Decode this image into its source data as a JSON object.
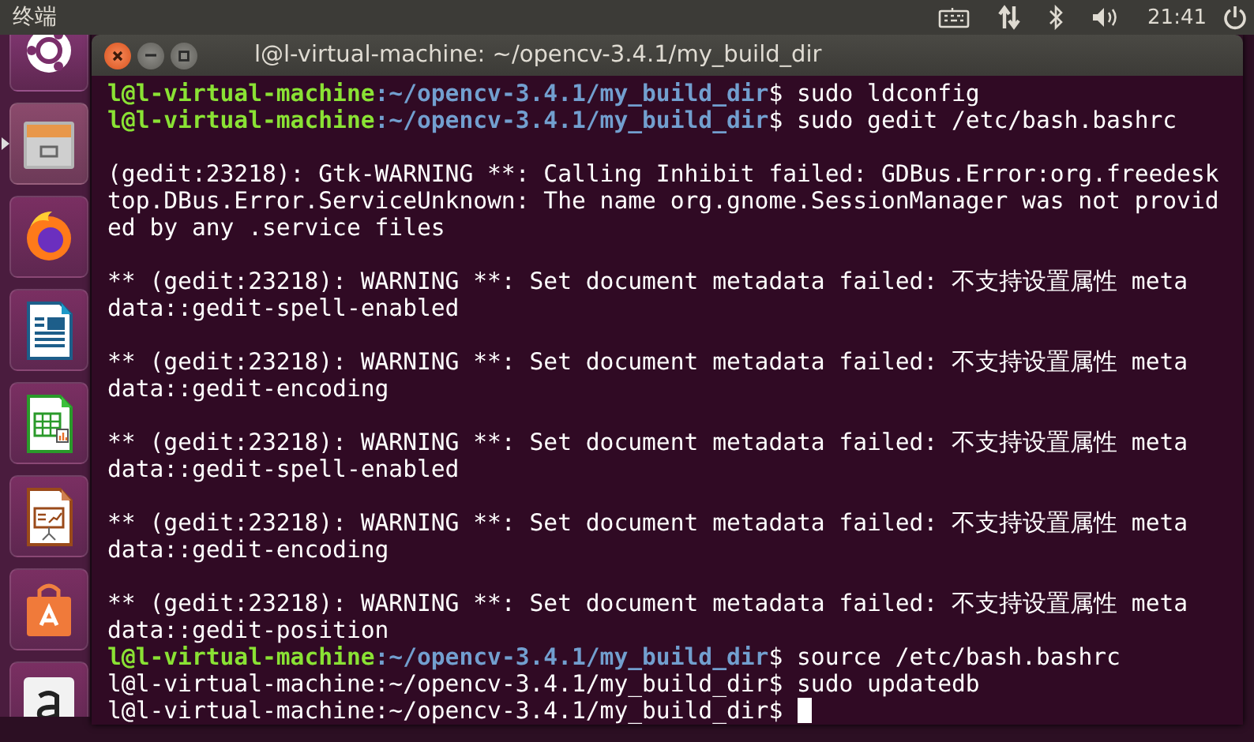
{
  "top_bar": {
    "app_title": "终端",
    "time": "21:41"
  },
  "launcher": {
    "items": [
      {
        "kind": "dash",
        "running": false
      },
      {
        "kind": "files",
        "running": true
      },
      {
        "kind": "browser",
        "running": false
      },
      {
        "kind": "writer",
        "running": false
      },
      {
        "kind": "calc",
        "running": false
      },
      {
        "kind": "impress",
        "running": false
      },
      {
        "kind": "software",
        "running": false
      },
      {
        "kind": "amazon",
        "running": false
      }
    ]
  },
  "terminal": {
    "title": "l@l-virtual-machine: ~/opencv-3.4.1/my_build_dir",
    "lines": [
      {
        "kind": "prompt",
        "colored": true,
        "user": "l@l-virtual-machine",
        "path": ":~/opencv-3.4.1/my_build_dir",
        "command": "$ sudo ldconfig"
      },
      {
        "kind": "prompt",
        "colored": true,
        "user": "l@l-virtual-machine",
        "path": ":~/opencv-3.4.1/my_build_dir",
        "command": "$ sudo gedit /etc/bash.bashrc"
      },
      {
        "kind": "blank"
      },
      {
        "kind": "output",
        "text": "(gedit:23218): Gtk-WARNING **: Calling Inhibit failed: GDBus.Error:org.freedesk"
      },
      {
        "kind": "output",
        "text": "top.DBus.Error.ServiceUnknown: The name org.gnome.SessionManager was not provid"
      },
      {
        "kind": "output",
        "text": "ed by any .service files"
      },
      {
        "kind": "blank"
      },
      {
        "kind": "output",
        "text": "** (gedit:23218): WARNING **: Set document metadata failed: 不支持设置属性 meta"
      },
      {
        "kind": "output",
        "text": "data::gedit-spell-enabled"
      },
      {
        "kind": "blank"
      },
      {
        "kind": "output",
        "text": "** (gedit:23218): WARNING **: Set document metadata failed: 不支持设置属性 meta"
      },
      {
        "kind": "output",
        "text": "data::gedit-encoding"
      },
      {
        "kind": "blank"
      },
      {
        "kind": "output",
        "text": "** (gedit:23218): WARNING **: Set document metadata failed: 不支持设置属性 meta"
      },
      {
        "kind": "output",
        "text": "data::gedit-spell-enabled"
      },
      {
        "kind": "blank"
      },
      {
        "kind": "output",
        "text": "** (gedit:23218): WARNING **: Set document metadata failed: 不支持设置属性 meta"
      },
      {
        "kind": "output",
        "text": "data::gedit-encoding"
      },
      {
        "kind": "blank"
      },
      {
        "kind": "output",
        "text": "** (gedit:23218): WARNING **: Set document metadata failed: 不支持设置属性 meta"
      },
      {
        "kind": "output",
        "text": "data::gedit-position"
      },
      {
        "kind": "prompt",
        "colored": true,
        "user": "l@l-virtual-machine",
        "path": ":~/opencv-3.4.1/my_build_dir",
        "command": "$ source /etc/bash.bashrc"
      },
      {
        "kind": "prompt",
        "colored": false,
        "user": "l@l-virtual-machine",
        "path": ":~/opencv-3.4.1/my_build_dir",
        "command": "$ sudo updatedb"
      },
      {
        "kind": "prompt",
        "colored": false,
        "user": "l@l-virtual-machine",
        "path": ":~/opencv-3.4.1/my_build_dir",
        "command": "$",
        "cursor": true
      }
    ]
  }
}
